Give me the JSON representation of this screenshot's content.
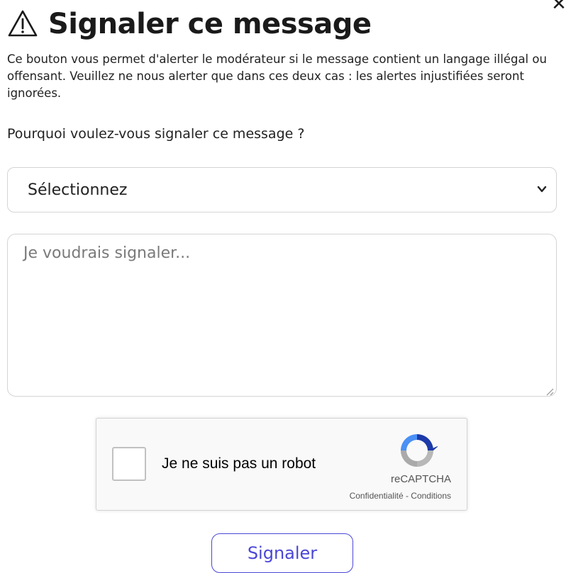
{
  "dialog": {
    "title": "Signaler ce message",
    "title_icon": "warning-triangle-icon",
    "close_icon": "close-icon",
    "close_label": "✕",
    "intro": "Ce bouton vous permet d'alerter le modérateur si le message contient un langage illégal ou offensant. Veuillez ne nous alerter que dans ces deux cas : les alertes injustifiées seront ignorées."
  },
  "form": {
    "question": "Pourquoi voulez-vous signaler ce message ?",
    "reason_select": {
      "selected": "Sélectionnez",
      "icon": "chevron-down-icon"
    },
    "details": {
      "placeholder": "Je voudrais signaler...",
      "value": ""
    },
    "submit_label": "Signaler"
  },
  "recaptcha": {
    "label": "Je ne suis pas un robot",
    "brand": "reCAPTCHA",
    "privacy": "Confidentialité",
    "separator": " - ",
    "terms": "Conditions",
    "checked": false
  },
  "colors": {
    "accent": "#4a47d6",
    "border": "#d4d4d4",
    "text": "#222222",
    "placeholder": "#7a7a7a",
    "captcha_bg": "#f9f9f9"
  }
}
